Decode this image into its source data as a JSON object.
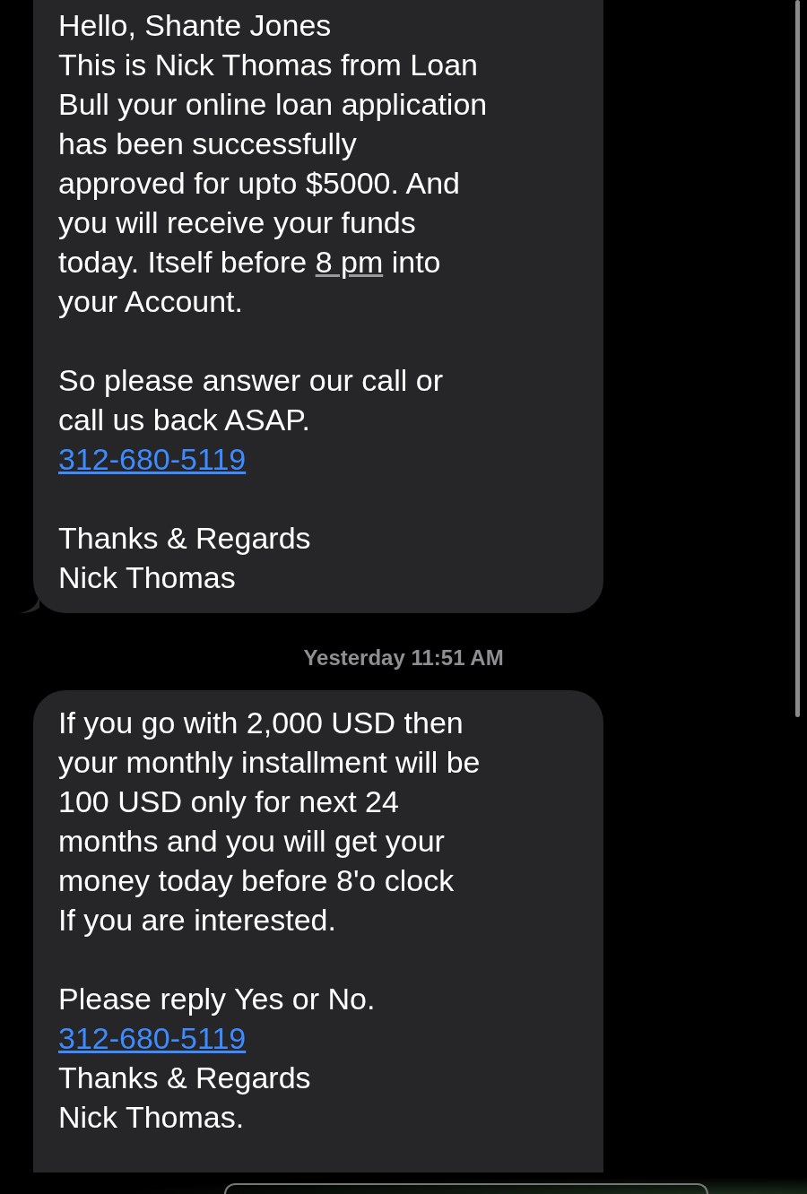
{
  "conversation": [
    {
      "kind": "message",
      "tail": true,
      "paragraphs": [
        [
          [
            {
              "kind": "text",
              "text": "Hello, Shante Jones"
            }
          ],
          [
            {
              "kind": "text",
              "text": "This is Nick Thomas from Loan"
            }
          ],
          [
            {
              "kind": "text",
              "text": "Bull your online loan application"
            }
          ],
          [
            {
              "kind": "text",
              "text": "has been successfully"
            }
          ],
          [
            {
              "kind": "text",
              "text": "approved for upto $5000. And"
            }
          ],
          [
            {
              "kind": "text",
              "text": "you will receive your funds"
            }
          ],
          [
            {
              "kind": "text",
              "text": "today. Itself before "
            },
            {
              "kind": "time",
              "text": "8 pm"
            },
            {
              "kind": "text",
              "text": " into"
            }
          ],
          [
            {
              "kind": "text",
              "text": "your Account."
            }
          ]
        ],
        [
          [
            {
              "kind": "text",
              "text": "So please answer our call or"
            }
          ],
          [
            {
              "kind": "text",
              "text": "call us back ASAP."
            }
          ],
          [
            {
              "kind": "link",
              "text": "312-680-5119"
            }
          ]
        ],
        [
          [
            {
              "kind": "text",
              "text": "Thanks & Regards"
            }
          ],
          [
            {
              "kind": "text",
              "text": "Nick Thomas"
            }
          ]
        ]
      ]
    },
    {
      "kind": "timestamp",
      "day": "Yesterday",
      "time": "11:51 AM"
    },
    {
      "kind": "message",
      "tail": false,
      "paragraphs": [
        [
          [
            {
              "kind": "text",
              "text": "If you go with 2,000 USD then"
            }
          ],
          [
            {
              "kind": "text",
              "text": "your monthly installment will be"
            }
          ],
          [
            {
              "kind": "text",
              "text": "100 USD only for next 24"
            }
          ],
          [
            {
              "kind": "text",
              "text": "months and you will get your"
            }
          ],
          [
            {
              "kind": "text",
              "text": "money today before 8'o clock"
            }
          ],
          [
            {
              "kind": "text",
              "text": "If you are interested."
            }
          ]
        ],
        [
          [
            {
              "kind": "text",
              "text": "Please reply Yes or No."
            }
          ],
          [
            {
              "kind": "link",
              "text": "312-680-5119"
            }
          ],
          [
            {
              "kind": "text",
              "text": "Thanks & Regards"
            }
          ],
          [
            {
              "kind": "text",
              "text": "Nick Thomas."
            }
          ]
        ]
      ]
    }
  ]
}
